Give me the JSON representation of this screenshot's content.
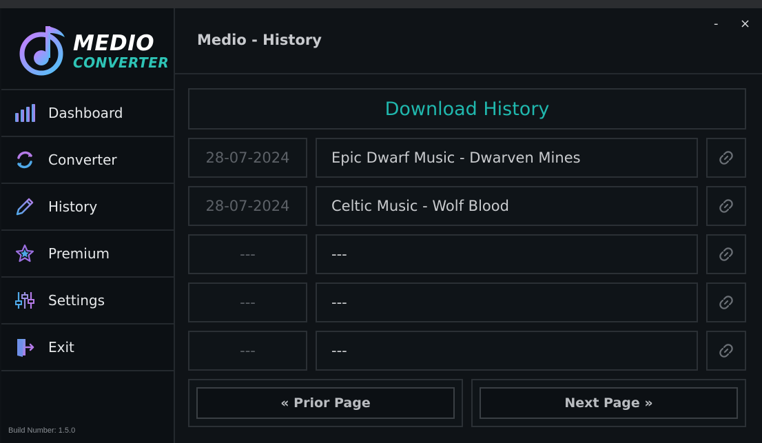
{
  "app": {
    "logo_title": "MEDIO",
    "logo_subtitle": "CONVERTER",
    "window_title": "Medio - History",
    "build_number": "Build Number: 1.5.0",
    "minimize": "-",
    "close": "×"
  },
  "sidebar": {
    "items": [
      {
        "label": "Dashboard",
        "icon": "bar-chart-icon"
      },
      {
        "label": "Converter",
        "icon": "refresh-icon"
      },
      {
        "label": "History",
        "icon": "pencil-icon"
      },
      {
        "label": "Premium",
        "icon": "star-icon"
      },
      {
        "label": "Settings",
        "icon": "sliders-icon"
      },
      {
        "label": "Exit",
        "icon": "exit-door-icon"
      }
    ]
  },
  "history": {
    "title": "Download History",
    "rows": [
      {
        "date": "28-07-2024",
        "name": "Epic Dwarf Music - Dwarven Mines"
      },
      {
        "date": "28-07-2024",
        "name": "Celtic Music - Wolf Blood"
      },
      {
        "date": "---",
        "name": "---"
      },
      {
        "date": "---",
        "name": "---"
      },
      {
        "date": "---",
        "name": "---"
      }
    ],
    "prior_page": "« Prior Page",
    "next_page": "Next Page »"
  },
  "colors": {
    "accent_teal": "#20b8ae",
    "accent_purple": "#9b6fe0",
    "accent_blue": "#4fa8e8"
  }
}
